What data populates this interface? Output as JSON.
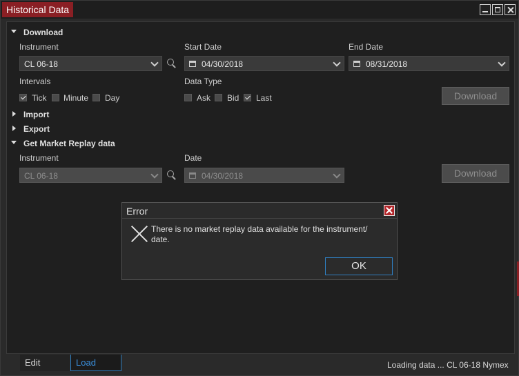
{
  "window": {
    "title": "Historical Data"
  },
  "download": {
    "heading": "Download",
    "instrument_label": "Instrument",
    "instrument_value": "CL 06-18",
    "start_date_label": "Start Date",
    "start_date_value": "04/30/2018",
    "end_date_label": "End Date",
    "end_date_value": "08/31/2018",
    "intervals_label": "Intervals",
    "intervals": [
      {
        "label": "Tick",
        "checked": true
      },
      {
        "label": "Minute",
        "checked": false
      },
      {
        "label": "Day",
        "checked": false
      }
    ],
    "data_type_label": "Data Type",
    "data_types": [
      {
        "label": "Ask",
        "checked": false
      },
      {
        "label": "Bid",
        "checked": false
      },
      {
        "label": "Last",
        "checked": true
      }
    ],
    "button_label": "Download"
  },
  "import": {
    "heading": "Import"
  },
  "export": {
    "heading": "Export"
  },
  "replay": {
    "heading": "Get Market Replay data",
    "instrument_label": "Instrument",
    "instrument_value": "CL 06-18",
    "date_label": "Date",
    "date_value": "04/30/2018",
    "button_label": "Download"
  },
  "dialog": {
    "title": "Error",
    "message": "There is no market replay data available for the instrument/ date.",
    "ok_label": "OK"
  },
  "footer": {
    "tabs": [
      {
        "label": "Edit"
      },
      {
        "label": "Load"
      }
    ],
    "status": "Loading data ... CL 06-18 Nymex"
  },
  "colors": {
    "accent": "#8a1f24",
    "focus": "#2f7fc1",
    "background": "#1f1f1f"
  }
}
